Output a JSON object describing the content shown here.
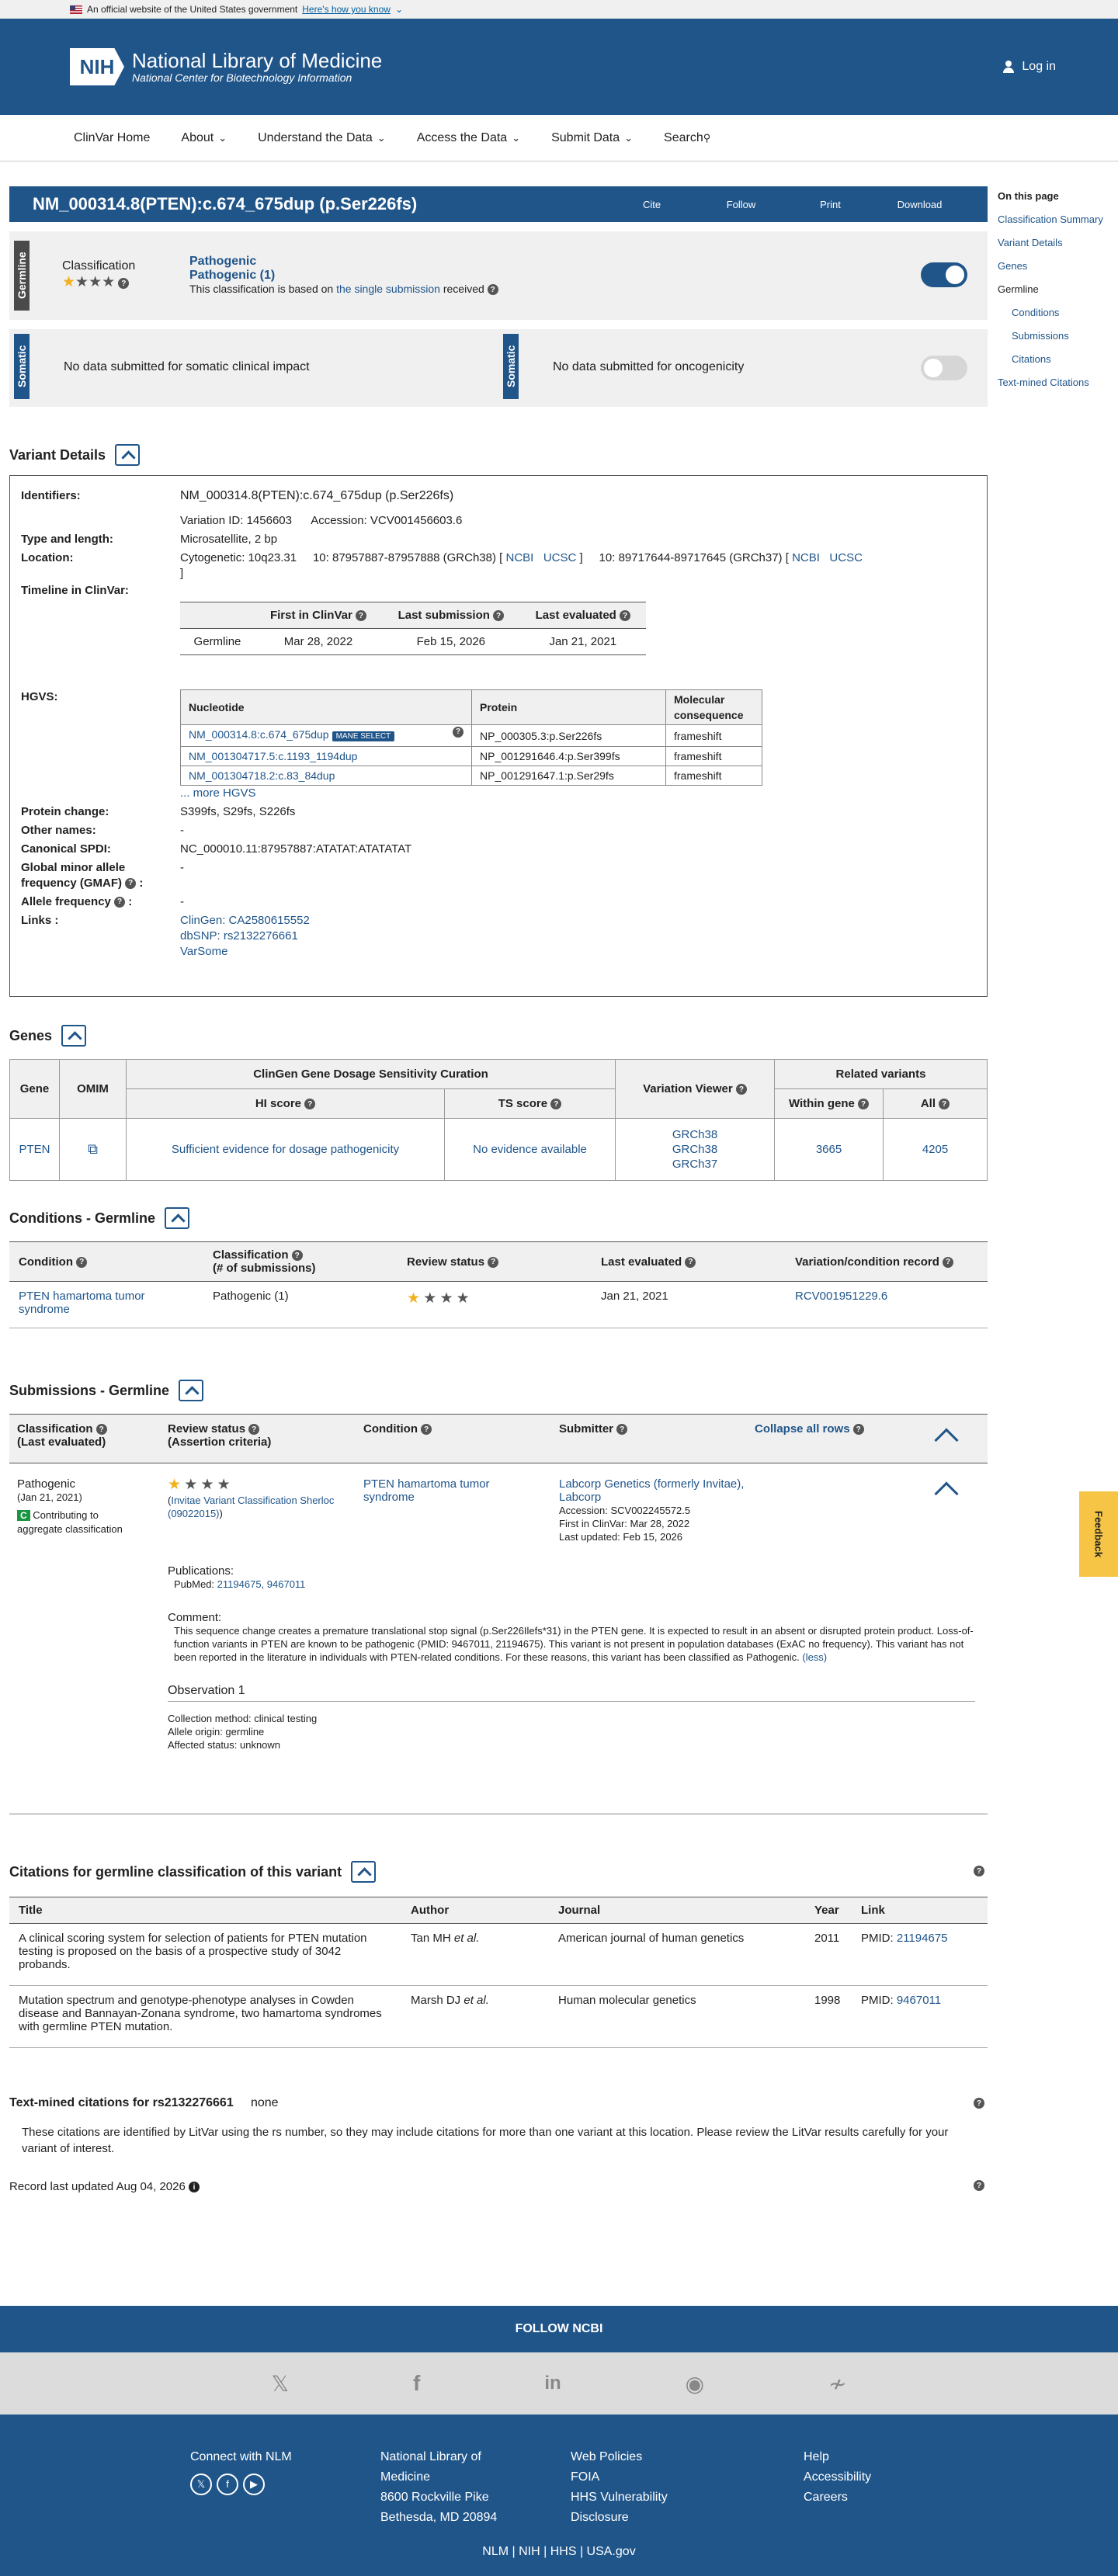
{
  "gov_banner": {
    "text": "An official website of the United States government",
    "link": "Here's how you know"
  },
  "header": {
    "logo_badge": "NIH",
    "logo_title": "National Library of Medicine",
    "logo_subtitle": "National Center for Biotechnology Information",
    "login": "Log in"
  },
  "nav": {
    "items": [
      "ClinVar Home",
      "About",
      "Understand the Data",
      "Access the Data",
      "Submit Data",
      "Search"
    ]
  },
  "sidebar": {
    "heading": "On this page",
    "items": [
      "Classification Summary",
      "Variant Details",
      "Genes"
    ],
    "group": "Germline",
    "sub_items": [
      "Conditions",
      "Submissions",
      "Citations"
    ],
    "last": "Text-mined Citations"
  },
  "title": {
    "text": "NM_000314.8(PTEN):c.674_675dup (p.Ser226fs)",
    "actions": [
      "Cite",
      "Follow",
      "Print",
      "Download"
    ]
  },
  "germline": {
    "vlabel": "Germline",
    "label": "Classification",
    "class_title": "Pathogenic",
    "class_sub": "Pathogenic (1)",
    "note_pre": "This classification is based on",
    "note_link": "the single submission",
    "note_post": "received"
  },
  "somatic": {
    "vlabel": "Somatic",
    "clinical": "No data submitted for somatic clinical impact",
    "onco": "No data submitted for oncogenicity"
  },
  "variant_details": {
    "heading": "Variant Details",
    "identifiers_k": "Identifiers:",
    "identifiers_v": "NM_000314.8(PTEN):c.674_675dup (p.Ser226fs)",
    "variation_id": "Variation ID: 1456603",
    "accession": "Accession: VCV001456603.6",
    "type_k": "Type and length:",
    "type_v": "Microsatellite, 2 bp",
    "location_k": "Location:",
    "cyto": "Cytogenetic: 10q23.31",
    "loc38": "10: 87957887-87957888 (GRCh38) [",
    "loc37": "10: 89717644-89717645 (GRCh37) [",
    "ncbi": "NCBI",
    "ucsc": "UCSC",
    "close": "]",
    "timeline_k": "Timeline in ClinVar:",
    "timeline_headers": [
      "First in ClinVar",
      "Last submission",
      "Last evaluated"
    ],
    "timeline_row": [
      "Germline",
      "Mar 28, 2022",
      "Feb 15, 2026",
      "Jan 21, 2021"
    ],
    "hgvs_k": "HGVS:",
    "hgvs_headers": [
      "Nucleotide",
      "Protein",
      "Molecular consequence"
    ],
    "hgvs_rows": [
      [
        "NM_000314.8:c.674_675dup",
        "NP_000305.3:p.Ser226fs",
        "frameshift"
      ],
      [
        "NM_001304717.5:c.1193_1194dup",
        "NP_001291646.4:p.Ser399fs",
        "frameshift"
      ],
      [
        "NM_001304718.2:c.83_84dup",
        "NP_001291647.1:p.Ser29fs",
        "frameshift"
      ]
    ],
    "mane": "MANE SELECT",
    "more_hgvs": "... more HGVS",
    "protein_k": "Protein change:",
    "protein_v": "S399fs, S29fs, S226fs",
    "other_k": "Other names:",
    "other_v": "-",
    "spdi_k": "Canonical SPDI:",
    "spdi_v": "NC_000010.11:87957887:ATATAT:ATATATAT",
    "gmaf_k": "Global minor allele frequency (GMAF)",
    "gmaf_v": "-",
    "af_k": "Allele frequency",
    "af_v": "-",
    "links_k": "Links :",
    "links": [
      "ClinGen: CA2580615552",
      "dbSNP: rs2132276661",
      "VarSome"
    ]
  },
  "genes": {
    "heading": "Genes",
    "h_gene": "Gene",
    "h_omim": "OMIM",
    "h_clingen": "ClinGen Gene Dosage Sensitivity Curation",
    "h_hi": "HI score",
    "h_ts": "TS score",
    "h_viewer": "Variation Viewer",
    "h_related": "Related variants",
    "h_within": "Within gene",
    "h_all": "All",
    "gene": "PTEN",
    "hi": "Sufficient evidence for dosage pathogenicity",
    "ts": "No evidence available",
    "viewer": [
      "GRCh38",
      "GRCh38",
      "GRCh37"
    ],
    "within": "3665",
    "all": "4205"
  },
  "conditions": {
    "heading": "Conditions - Germline",
    "headers": [
      "Condition",
      "Classification",
      "(# of submissions)",
      "Review status",
      "Last evaluated",
      "Variation/condition record"
    ],
    "condition": "PTEN hamartoma tumor syndrome",
    "classification": "Pathogenic (1)",
    "last_eval": "Jan 21, 2021",
    "record": "RCV001951229.6"
  },
  "submissions": {
    "heading": "Submissions - Germline",
    "h_class": "Classification",
    "h_class2": "(Last evaluated)",
    "h_review": "Review status",
    "h_review2": "(Assertion criteria)",
    "h_condition": "Condition",
    "h_submitter": "Submitter",
    "collapse": "Collapse all rows",
    "class": "Pathogenic",
    "date": "(Jan 21, 2021)",
    "contrib_badge": "C",
    "contrib": "Contributing to aggregate classification",
    "criteria_open": "(",
    "criteria": "Invitae Variant Classification Sherloc (09022015)",
    "criteria_close": ")",
    "condition": "PTEN hamartoma tumor syndrome",
    "submitter": "Labcorp Genetics (formerly Invitae), Labcorp",
    "accession": "Accession: SCV002245572.5",
    "first": "First in ClinVar: Mar 28, 2022",
    "updated": "Last updated: Feb 15, 2026",
    "pubs_label": "Publications:",
    "pubmed_label": "PubMed:",
    "pubmed_ids": "21194675, 9467011",
    "comment_label": "Comment:",
    "comment": "This sequence change creates a premature translational stop signal (p.Ser226Ilefs*31) in the PTEN gene. It is expected to result in an absent or disrupted protein product. Loss-of-function variants in PTEN are known to be pathogenic (PMID: 9467011, 21194675). This variant is not present in population databases (ExAC no frequency). This variant has not been reported in the literature in individuals with PTEN-related conditions. For these reasons, this variant has been classified as Pathogenic.",
    "less": "(less)",
    "obs": "Observation 1",
    "method": "Collection method: clinical testing",
    "origin": "Allele origin: germline",
    "affected": "Affected status: unknown"
  },
  "citations": {
    "heading": "Citations for germline classification of this variant",
    "headers": [
      "Title",
      "Author",
      "Journal",
      "Year",
      "Link"
    ],
    "rows": [
      {
        "title": "A clinical scoring system for selection of patients for PTEN mutation testing is proposed on the basis of a prospective study of 3042 probands.",
        "author": "Tan MH",
        "journal": "American journal of human genetics",
        "year": "2011",
        "pmid_label": "PMID:",
        "pmid": "21194675"
      },
      {
        "title": "Mutation spectrum and genotype-phenotype analyses in Cowden disease and Bannayan-Zonana syndrome, two hamartoma syndromes with germline PTEN mutation.",
        "author": "Marsh DJ",
        "journal": "Human molecular genetics",
        "year": "1998",
        "pmid_label": "PMID:",
        "pmid": "9467011"
      }
    ],
    "et_al": "et al."
  },
  "textmined": {
    "heading": "Text-mined citations for rs2132276661",
    "none": "none",
    "desc": "These citations are identified by LitVar using the rs number, so they may include citations for more than one variant at this location. Please review the LitVar results carefully for your variant of interest."
  },
  "record_updated": "Record last updated Aug 04, 2026",
  "feedback": "Feedback",
  "footer": {
    "follow": "FOLLOW NCBI",
    "connect": "Connect with NLM",
    "nlm": [
      "National Library of",
      "Medicine",
      "8600 Rockville Pike",
      "Bethesda, MD 20894"
    ],
    "policies": [
      "Web Policies",
      "FOIA",
      "HHS Vulnerability",
      "Disclosure"
    ],
    "help": [
      "Help",
      "Accessibility",
      "Careers"
    ],
    "bottom": "NLM | NIH | HHS | USA.gov"
  }
}
